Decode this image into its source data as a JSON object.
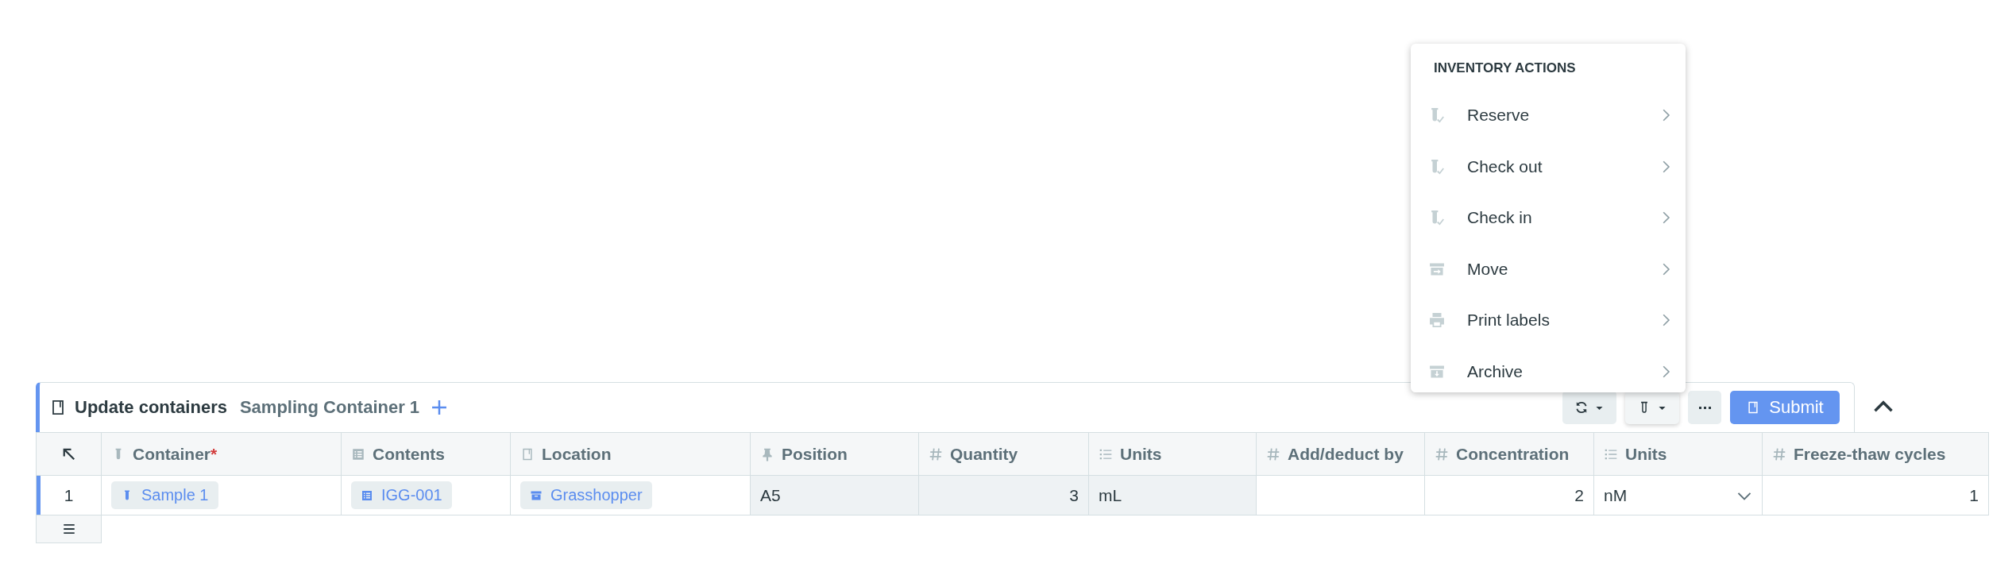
{
  "menu": {
    "title": "INVENTORY ACTIONS",
    "items": [
      {
        "label": "Reserve"
      },
      {
        "label": "Check out"
      },
      {
        "label": "Check in"
      },
      {
        "label": "Move"
      },
      {
        "label": "Print labels"
      },
      {
        "label": "Archive"
      }
    ]
  },
  "panel": {
    "title": "Update containers",
    "subtitle": "Sampling Container 1",
    "toolbar": [
      {
        "kind": "refresh",
        "active": false
      },
      {
        "kind": "tube",
        "active": true
      },
      {
        "kind": "more",
        "active": false
      }
    ],
    "submit": "Submit"
  },
  "table": {
    "columns": [
      {
        "label": "Container",
        "required_mark": "*"
      },
      {
        "label": "Contents"
      },
      {
        "label": "Location"
      },
      {
        "label": "Position"
      },
      {
        "label": "Quantity"
      },
      {
        "label": "Units"
      },
      {
        "label": "Add/deduct by"
      },
      {
        "label": "Concentration"
      },
      {
        "label": "Units"
      },
      {
        "label": "Freeze-thaw cycles"
      }
    ],
    "rows": [
      {
        "number": "1",
        "selected": true,
        "cells": [
          {
            "kind": "chip",
            "text": "Sample 1",
            "readonly": false
          },
          {
            "kind": "chip",
            "text": "IGG-001",
            "readonly": false
          },
          {
            "kind": "chip",
            "text": "Grasshopper",
            "readonly": false
          },
          {
            "kind": "text",
            "text": "A5",
            "readonly": true
          },
          {
            "kind": "number",
            "text": "3",
            "readonly": true
          },
          {
            "kind": "text",
            "text": "mL",
            "readonly": true
          },
          {
            "kind": "number",
            "readonly": false
          },
          {
            "kind": "number",
            "text": "2",
            "readonly": false
          },
          {
            "kind": "select",
            "text": "nM",
            "readonly": false
          },
          {
            "kind": "number",
            "text": "1",
            "readonly": false
          }
        ]
      }
    ]
  }
}
